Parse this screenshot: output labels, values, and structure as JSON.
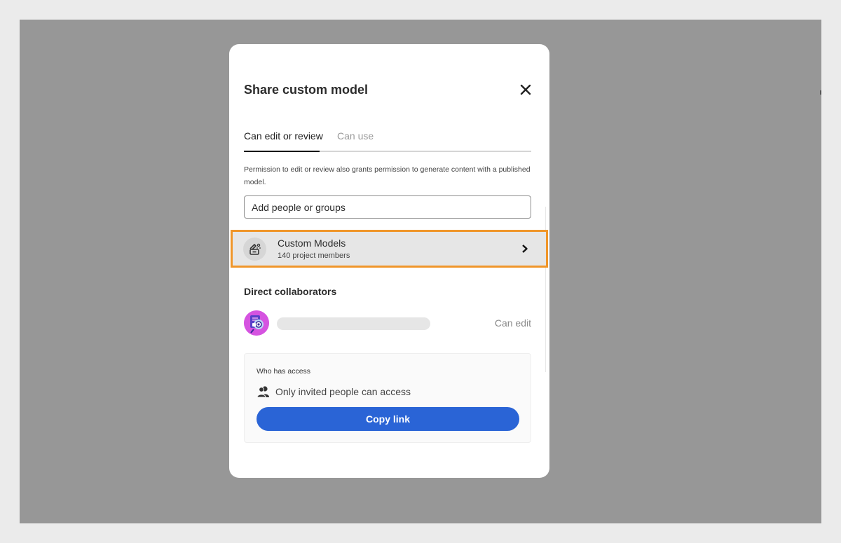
{
  "dialog": {
    "title": "Share custom model",
    "close_icon": "close-icon"
  },
  "tabs": [
    {
      "label": "Can edit or review",
      "active": true
    },
    {
      "label": "Can use",
      "active": false
    }
  ],
  "description": "Permission to edit or review also grants permission to generate content with a published model.",
  "add_input": {
    "value": "",
    "placeholder": "Add people or groups"
  },
  "group": {
    "name": "Custom Models",
    "members": "140 project members",
    "icon": "custom-model-icon",
    "highlight_color": "#f0962a"
  },
  "direct_collaborators": {
    "title": "Direct collaborators",
    "items": [
      {
        "name": "",
        "permission": "Can edit",
        "avatar": "avatar"
      }
    ]
  },
  "access": {
    "label": "Who has access",
    "status": "Only invited people can access",
    "icon": "people-icon",
    "copy_button": "Copy link",
    "button_color": "#2a64d6"
  }
}
